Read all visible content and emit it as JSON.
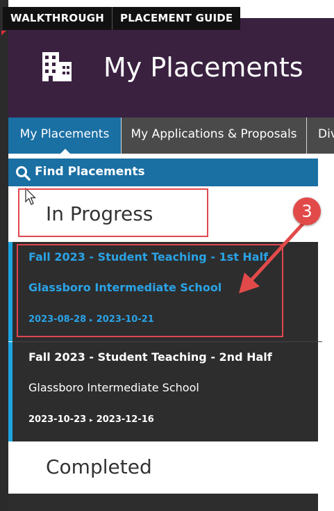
{
  "top_bar": {
    "walkthrough": "WALKTHROUGH",
    "placement_guide": "PLACEMENT GUIDE"
  },
  "header": {
    "title": "My Placements",
    "icon": "building-icon"
  },
  "tabs": [
    {
      "label": "My Placements",
      "active": true
    },
    {
      "label": "My Applications & Proposals",
      "active": false
    },
    {
      "label": "Div",
      "active": false
    }
  ],
  "find_bar": {
    "label": "Find Placements",
    "icon": "search-icon"
  },
  "sections": {
    "in_progress": "In Progress",
    "completed": "Completed"
  },
  "placements": [
    {
      "title": "Fall 2023 - Student Teaching - 1st Half",
      "school": "Glassboro Intermediate School",
      "start": "2023-08-28",
      "end": "2023-10-21"
    },
    {
      "title": "Fall 2023 - Student Teaching - 2nd Half",
      "school": "Glassboro Intermediate School",
      "start": "2023-10-23",
      "end": "2023-12-16"
    }
  ],
  "annotation": {
    "step": "3"
  },
  "colors": {
    "header_bg": "#3a2140",
    "accent_blue": "#1a6fa3",
    "link_blue": "#2aa3e6",
    "annotation_red": "#e24a4a",
    "item_bg": "#2d2d2d"
  }
}
